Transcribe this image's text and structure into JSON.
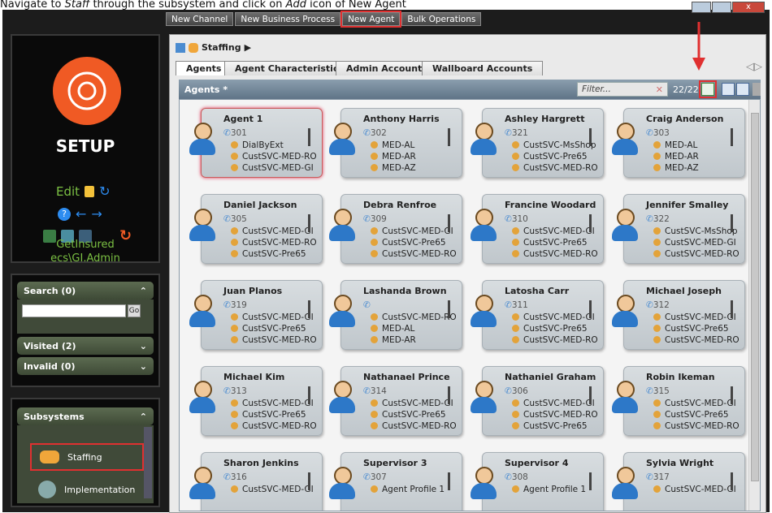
{
  "caption": {
    "text_pre": "Navigate to ",
    "text_i1": "Staff",
    "text_mid": " through the subsystem and click on ",
    "text_i2": "Add",
    "text_post": " icon of New Agent"
  },
  "topbar": {
    "buttons": [
      "New Channel",
      "New Business Process",
      "New Agent",
      "Bulk Operations"
    ]
  },
  "left": {
    "title": "SETUP",
    "edit_label": "Edit",
    "user_line1": "GetInsured",
    "user_line2": "ecs\\GI.Admin",
    "search": {
      "label": "Search (0)",
      "go": "Go"
    },
    "visited": "Visited (2)",
    "invalid": "Invalid (0)",
    "subsystems": {
      "label": "Subsystems",
      "items": [
        "Staffing",
        "Implementation"
      ]
    }
  },
  "breadcrumb": "Staffing",
  "tabs": [
    "Agents",
    "Agent Characteristics",
    "Admin Accounts",
    "Wallboard Accounts"
  ],
  "grid": {
    "title": "Agents *",
    "filter_placeholder": "Filter...",
    "count": "22/22"
  },
  "agents": [
    {
      "name": "Agent 1",
      "ext": "301",
      "profiles": [
        "DialByExt",
        "CustSVC-MED-RO",
        "CustSVC-MED-GI"
      ]
    },
    {
      "name": "Anthony Harris",
      "ext": "302",
      "profiles": [
        "MED-AL",
        "MED-AR",
        "MED-AZ"
      ]
    },
    {
      "name": "Ashley Hargrett",
      "ext": "321",
      "profiles": [
        "CustSVC-MsShop",
        "CustSVC-Pre65",
        "CustSVC-MED-RO"
      ]
    },
    {
      "name": "Craig Anderson",
      "ext": "303",
      "profiles": [
        "MED-AL",
        "MED-AR",
        "MED-AZ"
      ]
    },
    {
      "name": "Daniel Jackson",
      "ext": "305",
      "profiles": [
        "CustSVC-MED-GI",
        "CustSVC-MED-RO",
        "CustSVC-Pre65"
      ]
    },
    {
      "name": "Debra Renfroe",
      "ext": "309",
      "profiles": [
        "CustSVC-MED-GI",
        "CustSVC-Pre65",
        "CustSVC-MED-RO"
      ]
    },
    {
      "name": "Francine Woodard",
      "ext": "310",
      "profiles": [
        "CustSVC-MED-GI",
        "CustSVC-Pre65",
        "CustSVC-MED-RO"
      ]
    },
    {
      "name": "Jennifer Smalley",
      "ext": "322",
      "profiles": [
        "CustSVC-MsShop",
        "CustSVC-MED-GI",
        "CustSVC-MED-RO"
      ]
    },
    {
      "name": "Juan Planos",
      "ext": "319",
      "profiles": [
        "CustSVC-MED-GI",
        "CustSVC-Pre65",
        "CustSVC-MED-RO"
      ]
    },
    {
      "name": "Lashanda Brown",
      "ext": "",
      "profiles": [
        "CustSVC-MED-RO",
        "MED-AL",
        "MED-AR"
      ]
    },
    {
      "name": "Latosha Carr",
      "ext": "311",
      "profiles": [
        "CustSVC-MED-GI",
        "CustSVC-Pre65",
        "CustSVC-MED-RO"
      ]
    },
    {
      "name": "Michael Joseph",
      "ext": "312",
      "profiles": [
        "CustSVC-MED-GI",
        "CustSVC-Pre65",
        "CustSVC-MED-RO"
      ]
    },
    {
      "name": "Michael Kim",
      "ext": "313",
      "profiles": [
        "CustSVC-MED-GI",
        "CustSVC-Pre65",
        "CustSVC-MED-RO"
      ]
    },
    {
      "name": "Nathanael Prince",
      "ext": "314",
      "profiles": [
        "CustSVC-MED-GI",
        "CustSVC-Pre65",
        "CustSVC-MED-RO"
      ]
    },
    {
      "name": "Nathaniel Graham",
      "ext": "306",
      "profiles": [
        "CustSVC-MED-GI",
        "CustSVC-MED-RO",
        "CustSVC-Pre65"
      ]
    },
    {
      "name": "Robin Ikeman",
      "ext": "315",
      "profiles": [
        "CustSVC-MED-GI",
        "CustSVC-Pre65",
        "CustSVC-MED-RO"
      ]
    },
    {
      "name": "Sharon Jenkins",
      "ext": "316",
      "profiles": [
        "CustSVC-MED-GI"
      ]
    },
    {
      "name": "Supervisor 3",
      "ext": "307",
      "profiles": [
        "Agent Profile 1"
      ]
    },
    {
      "name": "Supervisor 4",
      "ext": "308",
      "profiles": [
        "Agent Profile 1"
      ]
    },
    {
      "name": "Sylvia Wright",
      "ext": "317",
      "profiles": [
        "CustSVC-MED-GI"
      ]
    }
  ],
  "colors": {
    "accent_green": "#7bc043",
    "setup_orange": "#f05a24",
    "highlight_red": "#e03030"
  }
}
